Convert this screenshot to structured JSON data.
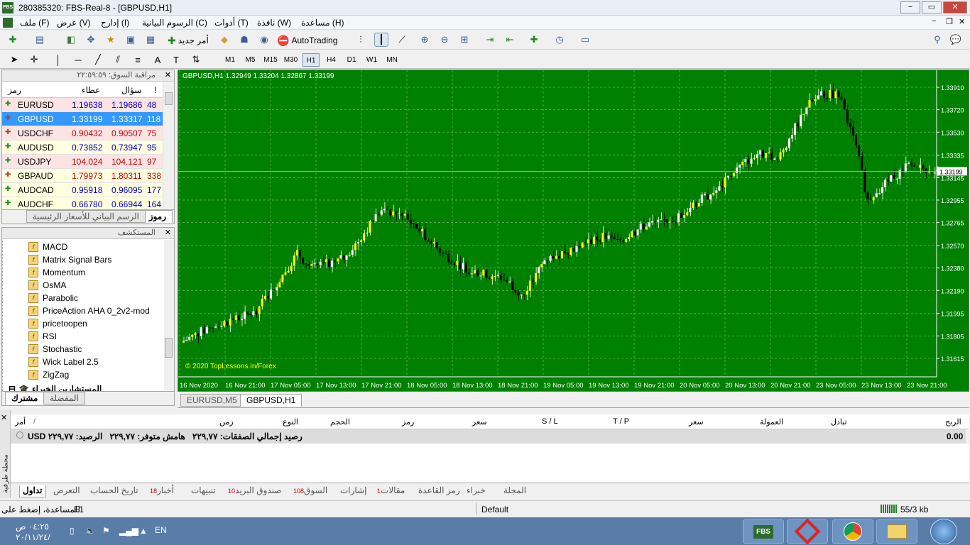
{
  "window": {
    "title": "280385320: FBS-Real-8 - [GBPUSD,H1]",
    "app_logo": "FBS",
    "min": "−",
    "max": "▭",
    "close": "✕"
  },
  "menu": [
    "ملف (F)",
    "عرض (V)",
    "إدارج (I)",
    "الرسوم البيانية (C)",
    "أدوات (T)",
    "نافذة (W)",
    "مساعدة (H)"
  ],
  "toolbar": {
    "new_order": "أمر جديد",
    "autotrading": "AutoTrading"
  },
  "timeframes": [
    "M1",
    "M5",
    "M15",
    "M30",
    "H1",
    "H4",
    "D1",
    "W1",
    "MN"
  ],
  "selected_timeframe": "H1",
  "market_watch": {
    "title": "مراقبة السوق: ٢٢:٥٩:٥٩",
    "headers": {
      "symbol": "رمز",
      "bid": "عطاء",
      "ask": "سؤال",
      "spread": "!"
    },
    "rows": [
      {
        "symbol": "EURUSD",
        "bid": "1.19638",
        "ask": "1.19686",
        "spread": "48",
        "bg": "#fde4e4",
        "dir": "up"
      },
      {
        "symbol": "GBPUSD",
        "bid": "1.33199",
        "ask": "1.33317",
        "spread": "118",
        "bg": "#3399ff",
        "dir": "down",
        "selected": true
      },
      {
        "symbol": "USDCHF",
        "bid": "0.90432",
        "ask": "0.90507",
        "spread": "75",
        "bg": "#fde4e4",
        "dir": "down"
      },
      {
        "symbol": "AUDUSD",
        "bid": "0.73852",
        "ask": "0.73947",
        "spread": "95",
        "bg": "#ffffe0",
        "dir": "up"
      },
      {
        "symbol": "USDJPY",
        "bid": "104.024",
        "ask": "104.121",
        "spread": "97",
        "bg": "#fde4e4",
        "dir": "up"
      },
      {
        "symbol": "GBPAUD",
        "bid": "1.79973",
        "ask": "1.80311",
        "spread": "338",
        "bg": "#ffffe0",
        "dir": "down"
      },
      {
        "symbol": "AUDCAD",
        "bid": "0.95918",
        "ask": "0.96095",
        "spread": "177",
        "bg": "#ffffe0",
        "dir": "up"
      },
      {
        "symbol": "AUDCHF",
        "bid": "0.66780",
        "ask": "0.66944",
        "spread": "164",
        "bg": "#ffffe0",
        "dir": "up"
      }
    ],
    "tabs": [
      "رموز",
      "الرسم البياني للأسعار الرئيسية"
    ]
  },
  "navigator": {
    "title": "المستكشف",
    "items": [
      "MACD",
      "Matrix Signal Bars",
      "Momentum",
      "OsMA",
      "Parabolic",
      "PriceAction AHA 0_2v2-mod",
      "pricetoopen",
      "RSI",
      "Stochastic",
      "Wick Label 2.5",
      "ZigZag"
    ],
    "experts_label": "المستشارين الخبراء",
    "tabs": [
      "مشترك",
      "المفضلة"
    ]
  },
  "chart": {
    "header": "GBPUSD,H1  1.32949 1.33204 1.32867 1.33199",
    "watermark": "© 2020 TopLessons.In/Forex",
    "price_labels": [
      "1.33910",
      "1.33720",
      "1.33530",
      "1.33335",
      "1.33145",
      "1.32955",
      "1.32765",
      "1.32570",
      "1.32380",
      "1.32190",
      "1.31995",
      "1.31805",
      "1.31615"
    ],
    "current_price": "1.33199",
    "time_labels": [
      "16 Nov 2020",
      "16 Nov 21:00",
      "17 Nov 05:00",
      "17 Nov 13:00",
      "17 Nov 21:00",
      "18 Nov 05:00",
      "18 Nov 13:00",
      "18 Nov 21:00",
      "19 Nov 05:00",
      "19 Nov 13:00",
      "19 Nov 21:00",
      "20 Nov 05:00",
      "20 Nov 13:00",
      "20 Nov 21:00",
      "23 Nov 05:00",
      "23 Nov 13:00",
      "23 Nov 21:00"
    ],
    "tabs": [
      "EURUSD,M5",
      "GBPUSD,H1"
    ],
    "colors": {
      "bg": "#008000",
      "bull": "#ffffff",
      "bull_alt": "#ffff00",
      "bear": "#000000",
      "grid": "#6abf6a"
    }
  },
  "terminal": {
    "side_label": "محطة طرفية",
    "headers": [
      "أمر",
      "زمن",
      "النوع",
      "الحجم",
      "رمز",
      "سعر",
      "S / L",
      "T / P",
      "سعر",
      "العمولة",
      "تبادل",
      "الربح"
    ],
    "sort_indicator": "/",
    "balance_row": "الرصيد: 229.77 USD  رصيد إجمالي الصفقات: 229.77  هامش متوفر: 229.77",
    "balance_text": {
      "balance": "الرصيد: ٢٢٩,٧٧ USD",
      "equity": "رصيد إجمالي الصفقات: ٢٢٩,٧٧",
      "free_margin": "هامش متوفر: ٢٢٩,٧٧"
    },
    "profit": "0.00",
    "tabs": [
      {
        "label": "تداول",
        "badge": ""
      },
      {
        "label": "التعرض",
        "badge": ""
      },
      {
        "label": "تاريخ الحساب",
        "badge": ""
      },
      {
        "label": "أخبار",
        "badge": "18"
      },
      {
        "label": "تنبيهات",
        "badge": ""
      },
      {
        "label": "صندوق البريد",
        "badge": "10"
      },
      {
        "label": "السوق",
        "badge": "108"
      },
      {
        "label": "إشارات",
        "badge": ""
      },
      {
        "label": "مقالات",
        "badge": "1"
      },
      {
        "label": "رمز القاعدة",
        "badge": ""
      },
      {
        "label": "خبراء",
        "badge": ""
      },
      {
        "label": "المجلة",
        "badge": ""
      }
    ]
  },
  "status": {
    "help": "للمساعدة، إضغط على",
    "key": "F1",
    "profile": "Default",
    "traffic": "55/3 kb"
  },
  "taskbar": {
    "time": "٠٤:٢٥ ص",
    "date": "٢٠/١١/٢٤/",
    "lang": "EN",
    "apps": [
      "FBS",
      "",
      "",
      ""
    ]
  }
}
